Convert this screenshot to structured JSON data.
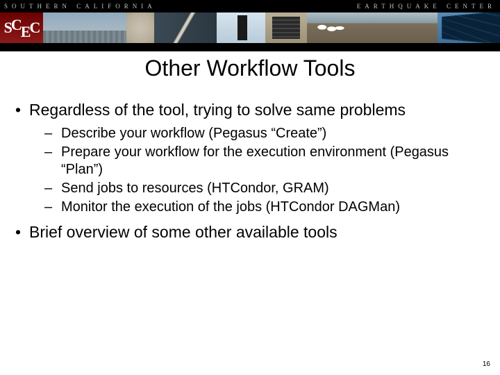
{
  "banner": {
    "org_left": "SOUTHERN CALIFORNIA",
    "org_right": "EARTHQUAKE CENTER",
    "logo_letters": "SCEC"
  },
  "title": "Other Workflow Tools",
  "bullets": [
    {
      "text": "Regardless of the tool, trying to solve same problems",
      "sub": [
        "Describe your workflow (Pegasus “Create”)",
        "Prepare your workflow for the execution environment (Pegasus “Plan”)",
        "Send jobs to resources (HTCondor, GRAM)",
        "Monitor the execution of the jobs (HTCondor DAGMan)"
      ]
    },
    {
      "text": "Brief overview of some other available tools",
      "sub": []
    }
  ],
  "page_number": "16"
}
